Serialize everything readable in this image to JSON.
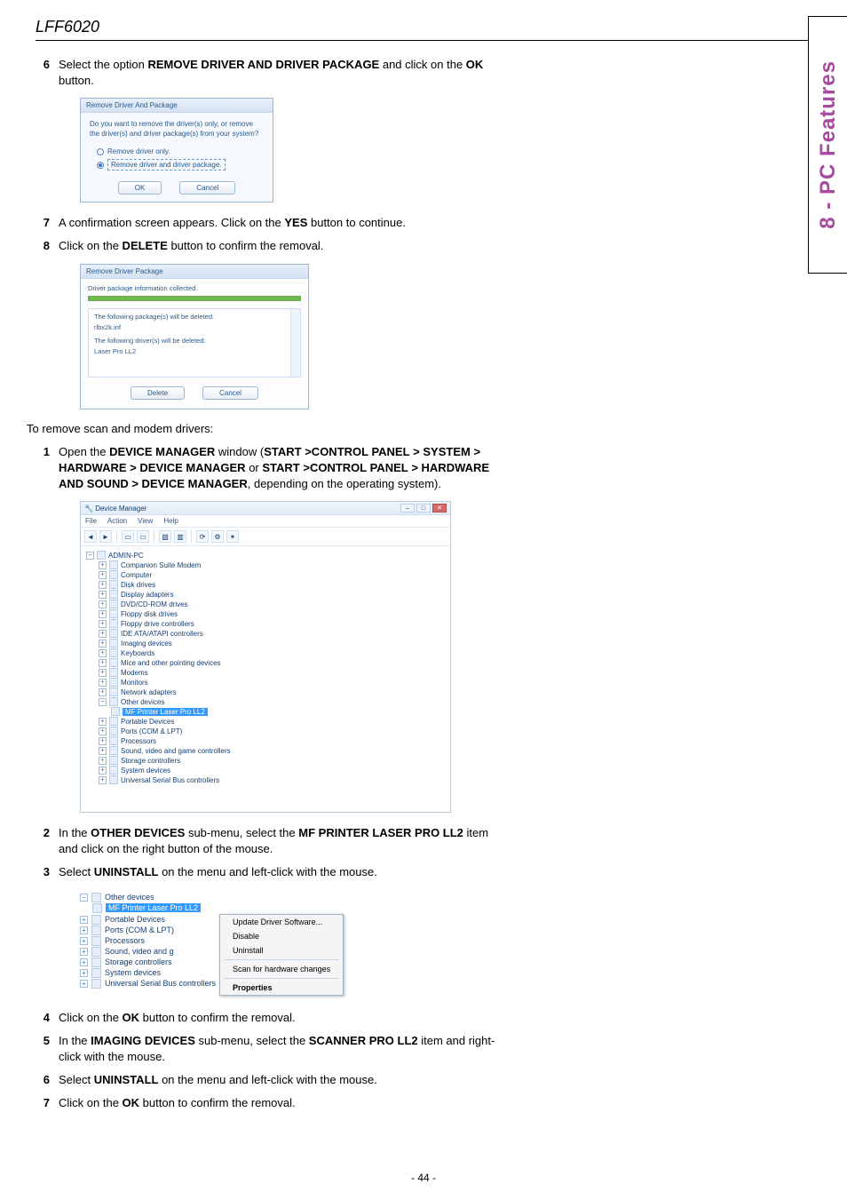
{
  "header": {
    "title": "LFF6020"
  },
  "side_tab": "8 - PC Features",
  "steps_a": [
    {
      "num": "6",
      "html": "Select the option <b>R<span class='sc'>EMOVE DRIVER AND DRIVER PACKAGE</span></b> and click on the <b>OK</b> button."
    }
  ],
  "dialog1": {
    "title": "Remove Driver And Package",
    "message": "Do you want to remove the driver(s) only, or remove the driver(s) and driver package(s) from your system?",
    "opt1": "Remove driver only.",
    "opt2": "Remove driver and driver package.",
    "ok": "OK",
    "cancel": "Cancel"
  },
  "steps_b": [
    {
      "num": "7",
      "html": "A confirmation screen appears. Click on the <b>Y<span class='sc'>ES</span></b> button to continue."
    },
    {
      "num": "8",
      "html": "Click on the <b>D<span class='sc'>ELETE</span></b> button to confirm the removal."
    }
  ],
  "dialog2": {
    "title": "Remove Driver Package",
    "line_collected": "Driver package information collected.",
    "line_pkg": "The following package(s) will be deleted:",
    "pkg": "rlbx2k.inf",
    "line_drv": "The following driver(s) will be deleted:",
    "drv": "Laser Pro LL2",
    "delete": "Delete",
    "cancel": "Cancel"
  },
  "intro": "To remove scan and modem drivers:",
  "steps_c": [
    {
      "num": "1",
      "html": "Open the <b>D<span class='sc'>EVICE MANAGER</span></b> window (<b>S<span class='sc'>TART</span> &gt;C<span class='sc'>ONTROL PANEL</span> &gt; S<span class='sc'>YSTEM</span> &gt; H<span class='sc'>ARDWARE</span> &gt; D<span class='sc'>EVICE MANAGER</span></b> or <b>S<span class='sc'>TART</span> &gt;C<span class='sc'>ONTROL PANEL</span> &gt; H<span class='sc'>ARDWARE AND SOUND</span> &gt; D<span class='sc'>EVICE MANAGER</span></b>, depending on the operating system)."
    }
  ],
  "devmgr": {
    "title": "Device Manager",
    "menus": [
      "File",
      "Action",
      "View",
      "Help"
    ],
    "root": "ADMIN-PC",
    "nodes": [
      "Companion Suite Modem",
      "Computer",
      "Disk drives",
      "Display adapters",
      "DVD/CD-ROM drives",
      "Floppy disk drives",
      "Floppy drive controllers",
      "IDE ATA/ATAPI controllers",
      "Imaging devices",
      "Keyboards",
      "Mice and other pointing devices",
      "Modems",
      "Monitors",
      "Network adapters"
    ],
    "other_devices": "Other devices",
    "selected": "MF Printer Laser Pro LL2",
    "nodes2": [
      "Portable Devices",
      "Ports (COM & LPT)",
      "Processors",
      "Sound, video and game controllers",
      "Storage controllers",
      "System devices",
      "Universal Serial Bus controllers"
    ]
  },
  "steps_d": [
    {
      "num": "2",
      "html": "In the <b>O<span class='sc'>THER DEVICES</span></b> sub-menu, select the <b>MF P<span class='sc'>RINTER</span> L<span class='sc'>ASER</span> P<span class='sc'>RO</span> LL2</b> item and click on the right button of the mouse."
    },
    {
      "num": "3",
      "html": "Select <b>U<span class='sc'>NINSTALL</span></b> on the menu and left-click with the mouse."
    }
  ],
  "ctx": {
    "other_devices": "Other devices",
    "selected": "MF Printer Laser Pro LL2",
    "siblings": [
      "Portable Devices",
      "Ports (COM & LPT)",
      "Processors",
      "Sound, video and g",
      "Storage controllers",
      "System devices",
      "Universal Serial Bus controllers"
    ],
    "menu": {
      "update": "Update Driver Software...",
      "disable": "Disable",
      "uninstall": "Uninstall",
      "scan": "Scan for hardware changes",
      "properties": "Properties"
    }
  },
  "steps_e": [
    {
      "num": "4",
      "html": "Click on the <b>OK</b> button to confirm the removal."
    },
    {
      "num": "5",
      "html": "In the <b>I<span class='sc'>MAGING DEVICES</span></b> sub-menu, select the <b>S<span class='sc'>CANNER</span> P<span class='sc'>RO</span> LL2</b> item and right-click with the mouse."
    },
    {
      "num": "6",
      "html": "Select <b>U<span class='sc'>NINSTALL</span></b> on the menu and left-click with the mouse."
    },
    {
      "num": "7",
      "html": "Click on the <b>OK</b> button to confirm the removal."
    }
  ],
  "footer": "- 44 -"
}
